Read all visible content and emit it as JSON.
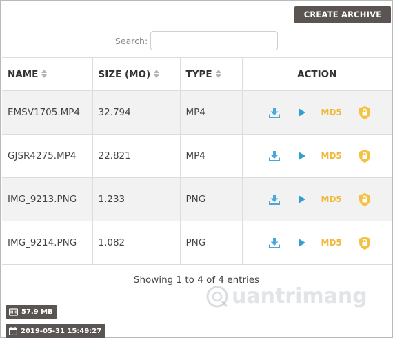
{
  "toolbar": {
    "create_archive_label": "CREATE ARCHIVE"
  },
  "search": {
    "label": "Search:",
    "value": "",
    "placeholder": ""
  },
  "table": {
    "columns": {
      "name": "NAME",
      "size": "SIZE (MO)",
      "type": "TYPE",
      "action": "ACTION"
    },
    "rows": [
      {
        "name": "EMSV1705.MP4",
        "size": "32.794",
        "type": "MP4",
        "md5": "MD5"
      },
      {
        "name": "GJSR4275.MP4",
        "size": "22.821",
        "type": "MP4",
        "md5": "MD5"
      },
      {
        "name": "IMG_9213.PNG",
        "size": "1.233",
        "type": "PNG",
        "md5": "MD5"
      },
      {
        "name": "IMG_9214.PNG",
        "size": "1.082",
        "type": "PNG",
        "md5": "MD5"
      }
    ]
  },
  "info": "Showing 1 to 4 of 4 entries",
  "badges": {
    "storage": "57.9 MB",
    "datetime": "2019-05-31 15:49:27"
  },
  "watermark": {
    "text": "uantrimang"
  },
  "icons": {
    "download": "download-icon",
    "play": "play-icon",
    "lock": "shield-lock-icon",
    "storage": "sd-card-icon",
    "calendar": "calendar-icon"
  },
  "colors": {
    "button_bg": "#5a5552",
    "download": "#4aa8d8",
    "play": "#2f9fd6",
    "md5": "#f0b93b",
    "lock": "#f3c242",
    "row_alt": "#f2f2f2"
  }
}
